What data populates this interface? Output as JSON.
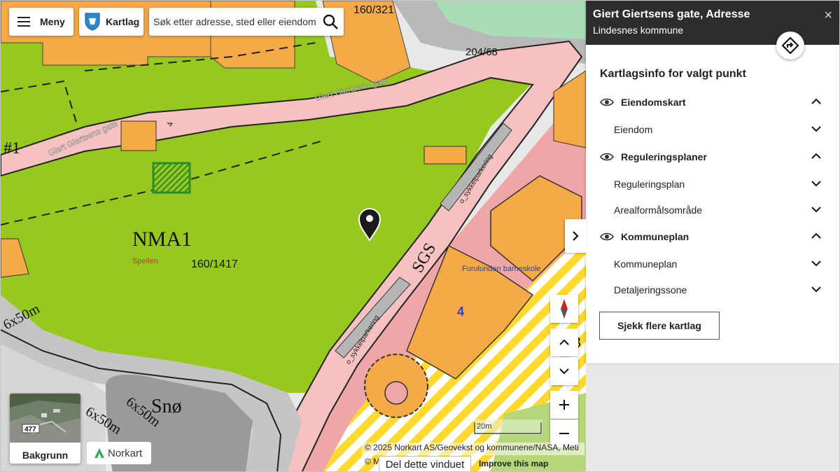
{
  "app": {
    "menu_label": "Meny",
    "layers_label": "Kartlag",
    "search_placeholder": "Søk etter adresse, sted eller eiendom"
  },
  "panel": {
    "title": "Giert Giertsens gate, Adresse",
    "subtitle": "Lindesnes kommune",
    "close_icon": "×",
    "heading": "Kartlagsinfo for valgt punkt",
    "groups": [
      {
        "label": "Eiendomskart",
        "expanded": true,
        "items": [
          "Eiendom"
        ]
      },
      {
        "label": "Reguleringsplaner",
        "expanded": true,
        "items": [
          "Reguleringsplan",
          "Arealformålsområde"
        ]
      },
      {
        "label": "Kommuneplan",
        "expanded": true,
        "items": [
          "Kommuneplan",
          "Detaljeringssone"
        ]
      }
    ],
    "more_layers_label": "Sjekk flere kartlag"
  },
  "map_labels": {
    "zone": "NMA1",
    "parcel_main": "160/1417",
    "parcel_top": "160/321",
    "parcel_right": "204/68",
    "street_1": "Giert Giertsens gate",
    "street_2": "Giert Giertsens gate",
    "place": "Speilen",
    "school": "Furulunden barneskole",
    "cycle_1": "o_sykkelparkering",
    "cycle_2": "o_sykkelparkering",
    "sgs": "SGS",
    "dim_1": "6x50m",
    "dim_2": "6x50m",
    "dim_3": "6x50m",
    "sno": "Snø",
    "hash": "#1",
    "road_no": "477",
    "small_num": "4",
    "num_4": "4",
    "edge_num": "3"
  },
  "controls": {
    "background_label": "Bakgrunn",
    "logo_label": "Norkart",
    "scale_label": "20m",
    "attribution": "© 2025 Norkart AS/Geovekst og kommunene/NASA, Meti",
    "attribution_2": "© M",
    "improve_label": "Improve this map",
    "share_label": "Del dette vinduet"
  },
  "colors": {
    "green_area": "#96c81e",
    "building": "#f5a947",
    "road": "#f6c1c1",
    "asphalt": "#b5b5b5",
    "hatch_yellow": "#ffd700",
    "panel_header": "#2d2d2d"
  }
}
